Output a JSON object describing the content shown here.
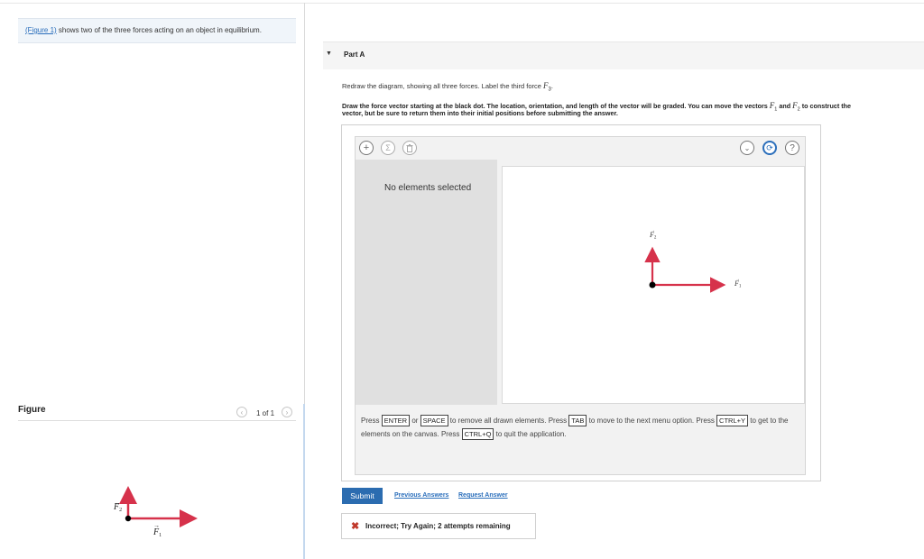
{
  "intro": {
    "link": "(Figure 1)",
    "text": " shows two of the three forces acting on an object in equilibrium."
  },
  "figure": {
    "label": "Figure",
    "pager": "1 of 1",
    "vec1": "F",
    "vec1_sub": "1",
    "vec2": "F",
    "vec2_sub": "2",
    "colors": {
      "horizontal": "#d6324b",
      "vertical": "#d6324b",
      "dot": "#000000"
    }
  },
  "part": {
    "title": "Part A",
    "prompt_pre": "Redraw the diagram, showing all three forces. Label the third force ",
    "prompt_vec": "F",
    "prompt_sub": "3",
    "prompt_post": ".",
    "instr1_a": "Draw the force vector starting at the black dot. The location, orientation, and length of the vector will be graded. You can move the vectors ",
    "instr1_v1": "F",
    "instr1_s1": "1",
    "instr1_and": " and ",
    "instr1_v2": "F",
    "instr1_s2": "2",
    "instr1_b": " to construct the",
    "instr2": "vector, but be sure to return them into their initial positions before submitting the answer."
  },
  "tool": {
    "no_elements": "No elements selected",
    "help": "?",
    "canvas_f1": "F",
    "canvas_f1_sub": "1",
    "canvas_f2": "F",
    "canvas_f2_sub": "2",
    "instructions": {
      "t1": "Press ",
      "k1": "ENTER",
      "t2": " or ",
      "k2": "SPACE",
      "t3": " to remove all drawn elements. Press ",
      "k3": "TAB",
      "t4": " to move to the next menu option. Press ",
      "k4": "CTRL+Y",
      "t5": " to get to the elements on the canvas. Press ",
      "k5": "CTRL+Q",
      "t6": " to quit the application."
    }
  },
  "actions": {
    "submit": "Submit",
    "previous": "Previous Answers",
    "request": "Request Answer"
  },
  "feedback": {
    "icon": "✖",
    "text": "Incorrect; Try Again; 2 attempts remaining"
  }
}
